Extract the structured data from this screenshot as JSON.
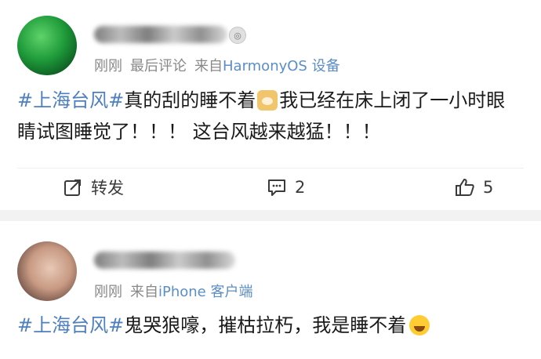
{
  "posts": [
    {
      "meta_time": "刚刚",
      "meta_tag": "最后评论",
      "meta_source_prefix": "来自",
      "meta_source_name": "HarmonyOS 设备",
      "content_tag": "#上海台风#",
      "content_text1": "真的刮的睡不着",
      "content_text2": "我已经在床上闭了一小时眼睛试图睡觉了！！！ 这台风越来越猛！！！",
      "actions": {
        "repost_label": "转发",
        "comment_count": "2",
        "like_count": "5"
      }
    },
    {
      "meta_time": "刚刚",
      "meta_source_prefix": "来自",
      "meta_source_name": "iPhone 客户端",
      "content_tag": "#上海台风#",
      "content_text": "鬼哭狼嚎，摧枯拉朽，我是睡不着"
    }
  ],
  "icons": {
    "repost": "repost-icon",
    "comment": "comment-icon",
    "like": "thumbs-up-icon",
    "emoji_dog": "dog-emoji-icon",
    "emoji_laugh": "laughing-emoji-icon"
  },
  "colors": {
    "link_blue": "#4e7fc0",
    "meta_gray": "#888888",
    "separator": "#f2f2f2"
  }
}
